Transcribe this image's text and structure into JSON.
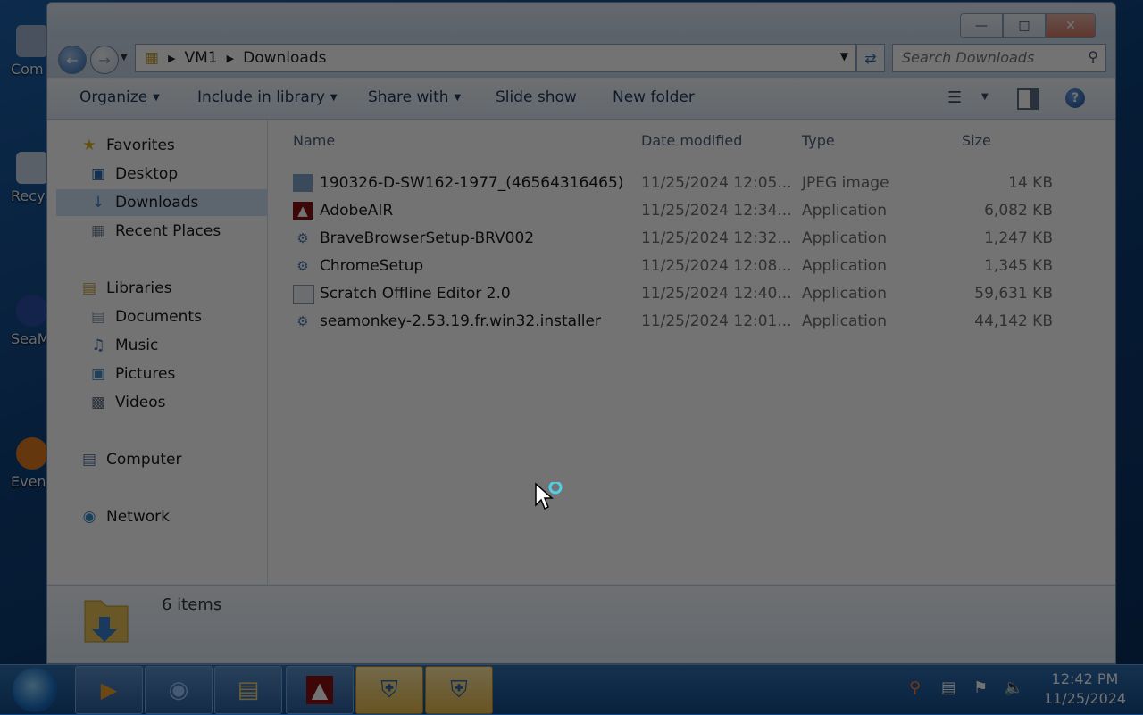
{
  "desktop": {
    "icons": [
      {
        "label": "Com",
        "color": "#9fb3cf"
      },
      {
        "label": "Recy",
        "color": "#c8d6e6"
      },
      {
        "label": "SeaM",
        "color": "#2b4fa8"
      },
      {
        "label": "Even",
        "color": "#e07a20"
      }
    ]
  },
  "window": {
    "address": {
      "segments": [
        "VM1",
        "Downloads"
      ]
    },
    "search": {
      "placeholder": "Search Downloads"
    },
    "toolbar": {
      "organize": "Organize",
      "include_in_library": "Include in library",
      "share_with": "Share with",
      "slide_show": "Slide show",
      "new_folder": "New folder"
    },
    "nav": {
      "favorites": "Favorites",
      "desktop": "Desktop",
      "downloads": "Downloads",
      "recent_places": "Recent Places",
      "libraries": "Libraries",
      "documents": "Documents",
      "music": "Music",
      "pictures": "Pictures",
      "videos": "Videos",
      "computer": "Computer",
      "network": "Network"
    },
    "columns": {
      "name": "Name",
      "date_modified": "Date modified",
      "type": "Type",
      "size": "Size"
    },
    "files": [
      {
        "name": "190326-D-SW162-1977_(46564316465)",
        "date": "11/25/2024 12:05...",
        "type": "JPEG image",
        "size": "14 KB",
        "icon": "image-icon"
      },
      {
        "name": "AdobeAIR",
        "date": "11/25/2024 12:34...",
        "type": "Application",
        "size": "6,082 KB",
        "icon": "adobe-air-icon"
      },
      {
        "name": "BraveBrowserSetup-BRV002",
        "date": "11/25/2024 12:32...",
        "type": "Application",
        "size": "1,247 KB",
        "icon": "installer-icon"
      },
      {
        "name": "ChromeSetup",
        "date": "11/25/2024 12:08...",
        "type": "Application",
        "size": "1,345 KB",
        "icon": "installer-icon"
      },
      {
        "name": "Scratch Offline Editor 2.0",
        "date": "11/25/2024 12:40...",
        "type": "Application",
        "size": "59,631 KB",
        "icon": "application-icon"
      },
      {
        "name": "seamonkey-2.53.19.fr.win32.installer",
        "date": "11/25/2024 12:01...",
        "type": "Application",
        "size": "44,142 KB",
        "icon": "installer-icon"
      }
    ],
    "status": {
      "item_count": "6 items"
    }
  },
  "taskbar": {
    "clock_time": "12:42 PM",
    "clock_date": "11/25/2024"
  }
}
